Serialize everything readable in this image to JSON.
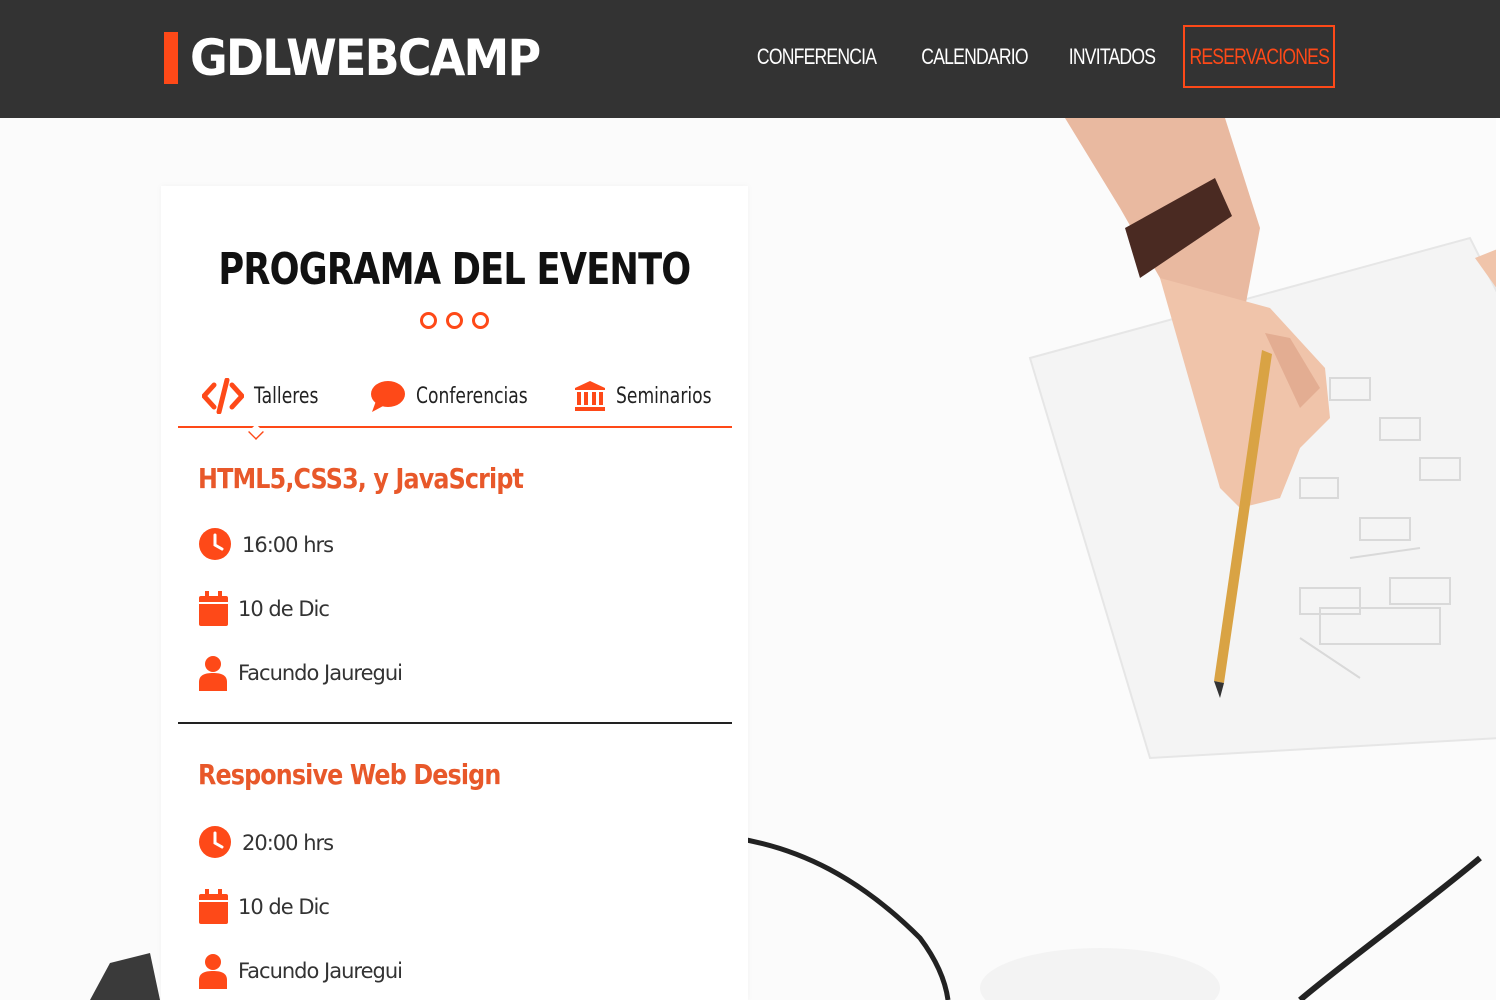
{
  "header": {
    "logo": "GDLWEBCAMP",
    "nav": [
      "CONFERENCIA",
      "CALENDARIO",
      "INVITADOS"
    ],
    "cta": "RESERVACIONES"
  },
  "program": {
    "title": "PROGRAMA DEL EVENTO",
    "tabs": [
      {
        "label": "Talleres",
        "icon": "code-icon"
      },
      {
        "label": "Conferencias",
        "icon": "comment-icon"
      },
      {
        "label": "Seminarios",
        "icon": "university-icon"
      }
    ],
    "events": [
      {
        "title": "HTML5,CSS3, y JavaScript",
        "time": "16:00 hrs",
        "date": "10 de Dic",
        "speaker": "Facundo Jauregui"
      },
      {
        "title": "Responsive Web Design",
        "time": "20:00 hrs",
        "date": "10 de Dic",
        "speaker": "Facundo Jauregui"
      }
    ]
  },
  "colors": {
    "accent": "#fe4918",
    "header_bg": "#333333",
    "event_title": "#e8582a"
  }
}
